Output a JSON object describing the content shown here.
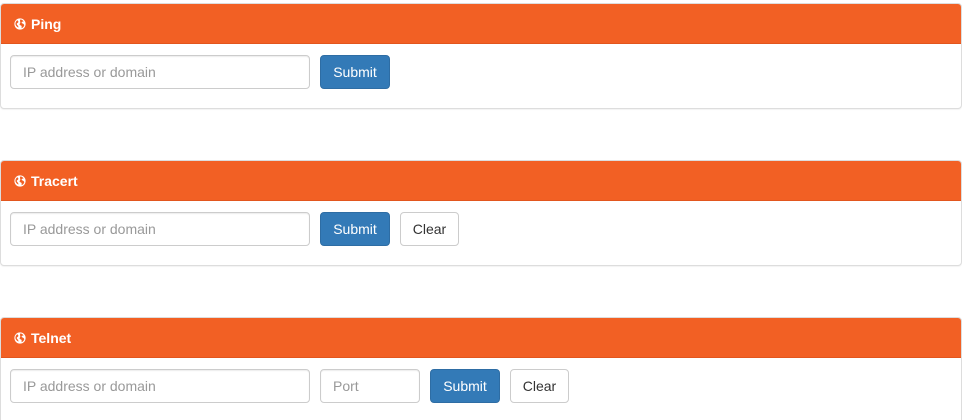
{
  "panels": {
    "ping": {
      "title": "Ping",
      "ip_placeholder": "IP address or domain",
      "ip_value": "",
      "submit_label": "Submit"
    },
    "tracert": {
      "title": "Tracert",
      "ip_placeholder": "IP address or domain",
      "ip_value": "",
      "submit_label": "Submit",
      "clear_label": "Clear"
    },
    "telnet": {
      "title": "Telnet",
      "ip_placeholder": "IP address or domain",
      "ip_value": "",
      "port_placeholder": "Port",
      "port_value": "",
      "submit_label": "Submit",
      "clear_label": "Clear"
    }
  },
  "icons": {
    "panel_heading": "globe-icon"
  },
  "colors": {
    "heading_bg": "#f26024",
    "primary_button": "#337ab7",
    "heading_text": "#ffffff"
  }
}
